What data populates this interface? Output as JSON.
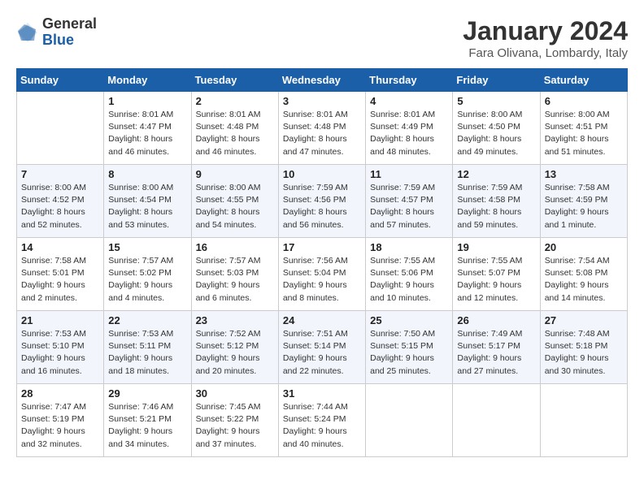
{
  "logo": {
    "general": "General",
    "blue": "Blue"
  },
  "header": {
    "title": "January 2024",
    "subtitle": "Fara Olivana, Lombardy, Italy"
  },
  "columns": [
    "Sunday",
    "Monday",
    "Tuesday",
    "Wednesday",
    "Thursday",
    "Friday",
    "Saturday"
  ],
  "weeks": [
    [
      {
        "day": "",
        "info": ""
      },
      {
        "day": "1",
        "info": "Sunrise: 8:01 AM\nSunset: 4:47 PM\nDaylight: 8 hours\nand 46 minutes."
      },
      {
        "day": "2",
        "info": "Sunrise: 8:01 AM\nSunset: 4:48 PM\nDaylight: 8 hours\nand 46 minutes."
      },
      {
        "day": "3",
        "info": "Sunrise: 8:01 AM\nSunset: 4:48 PM\nDaylight: 8 hours\nand 47 minutes."
      },
      {
        "day": "4",
        "info": "Sunrise: 8:01 AM\nSunset: 4:49 PM\nDaylight: 8 hours\nand 48 minutes."
      },
      {
        "day": "5",
        "info": "Sunrise: 8:00 AM\nSunset: 4:50 PM\nDaylight: 8 hours\nand 49 minutes."
      },
      {
        "day": "6",
        "info": "Sunrise: 8:00 AM\nSunset: 4:51 PM\nDaylight: 8 hours\nand 51 minutes."
      }
    ],
    [
      {
        "day": "7",
        "info": "Sunrise: 8:00 AM\nSunset: 4:52 PM\nDaylight: 8 hours\nand 52 minutes."
      },
      {
        "day": "8",
        "info": "Sunrise: 8:00 AM\nSunset: 4:54 PM\nDaylight: 8 hours\nand 53 minutes."
      },
      {
        "day": "9",
        "info": "Sunrise: 8:00 AM\nSunset: 4:55 PM\nDaylight: 8 hours\nand 54 minutes."
      },
      {
        "day": "10",
        "info": "Sunrise: 7:59 AM\nSunset: 4:56 PM\nDaylight: 8 hours\nand 56 minutes."
      },
      {
        "day": "11",
        "info": "Sunrise: 7:59 AM\nSunset: 4:57 PM\nDaylight: 8 hours\nand 57 minutes."
      },
      {
        "day": "12",
        "info": "Sunrise: 7:59 AM\nSunset: 4:58 PM\nDaylight: 8 hours\nand 59 minutes."
      },
      {
        "day": "13",
        "info": "Sunrise: 7:58 AM\nSunset: 4:59 PM\nDaylight: 9 hours\nand 1 minute."
      }
    ],
    [
      {
        "day": "14",
        "info": "Sunrise: 7:58 AM\nSunset: 5:01 PM\nDaylight: 9 hours\nand 2 minutes."
      },
      {
        "day": "15",
        "info": "Sunrise: 7:57 AM\nSunset: 5:02 PM\nDaylight: 9 hours\nand 4 minutes."
      },
      {
        "day": "16",
        "info": "Sunrise: 7:57 AM\nSunset: 5:03 PM\nDaylight: 9 hours\nand 6 minutes."
      },
      {
        "day": "17",
        "info": "Sunrise: 7:56 AM\nSunset: 5:04 PM\nDaylight: 9 hours\nand 8 minutes."
      },
      {
        "day": "18",
        "info": "Sunrise: 7:55 AM\nSunset: 5:06 PM\nDaylight: 9 hours\nand 10 minutes."
      },
      {
        "day": "19",
        "info": "Sunrise: 7:55 AM\nSunset: 5:07 PM\nDaylight: 9 hours\nand 12 minutes."
      },
      {
        "day": "20",
        "info": "Sunrise: 7:54 AM\nSunset: 5:08 PM\nDaylight: 9 hours\nand 14 minutes."
      }
    ],
    [
      {
        "day": "21",
        "info": "Sunrise: 7:53 AM\nSunset: 5:10 PM\nDaylight: 9 hours\nand 16 minutes."
      },
      {
        "day": "22",
        "info": "Sunrise: 7:53 AM\nSunset: 5:11 PM\nDaylight: 9 hours\nand 18 minutes."
      },
      {
        "day": "23",
        "info": "Sunrise: 7:52 AM\nSunset: 5:12 PM\nDaylight: 9 hours\nand 20 minutes."
      },
      {
        "day": "24",
        "info": "Sunrise: 7:51 AM\nSunset: 5:14 PM\nDaylight: 9 hours\nand 22 minutes."
      },
      {
        "day": "25",
        "info": "Sunrise: 7:50 AM\nSunset: 5:15 PM\nDaylight: 9 hours\nand 25 minutes."
      },
      {
        "day": "26",
        "info": "Sunrise: 7:49 AM\nSunset: 5:17 PM\nDaylight: 9 hours\nand 27 minutes."
      },
      {
        "day": "27",
        "info": "Sunrise: 7:48 AM\nSunset: 5:18 PM\nDaylight: 9 hours\nand 30 minutes."
      }
    ],
    [
      {
        "day": "28",
        "info": "Sunrise: 7:47 AM\nSunset: 5:19 PM\nDaylight: 9 hours\nand 32 minutes."
      },
      {
        "day": "29",
        "info": "Sunrise: 7:46 AM\nSunset: 5:21 PM\nDaylight: 9 hours\nand 34 minutes."
      },
      {
        "day": "30",
        "info": "Sunrise: 7:45 AM\nSunset: 5:22 PM\nDaylight: 9 hours\nand 37 minutes."
      },
      {
        "day": "31",
        "info": "Sunrise: 7:44 AM\nSunset: 5:24 PM\nDaylight: 9 hours\nand 40 minutes."
      },
      {
        "day": "",
        "info": ""
      },
      {
        "day": "",
        "info": ""
      },
      {
        "day": "",
        "info": ""
      }
    ]
  ]
}
